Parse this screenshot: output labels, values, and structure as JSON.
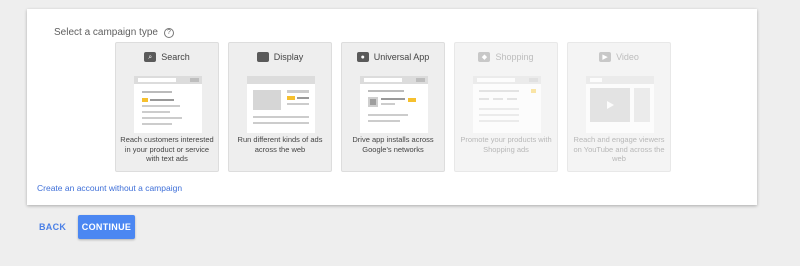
{
  "heading": "Select a campaign type",
  "help_icon": "?",
  "cards": [
    {
      "title": "Search",
      "icon": "search-icon",
      "glyph": "⌕",
      "description": "Reach customers interested in your product or service with text ads",
      "disabled": false
    },
    {
      "title": "Display",
      "icon": "display-icon",
      "glyph": "",
      "description": "Run different kinds of ads across the web",
      "disabled": false
    },
    {
      "title": "Universal App",
      "icon": "app-icon",
      "glyph": "●",
      "description": "Drive app installs across Google's networks",
      "disabled": false
    },
    {
      "title": "Shopping",
      "icon": "shopping-tag-icon",
      "glyph": "◆",
      "description": "Promote your products with Shopping ads",
      "disabled": true
    },
    {
      "title": "Video",
      "icon": "video-camera-icon",
      "glyph": "▶",
      "description": "Reach and engage viewers on YouTube and across the web",
      "disabled": true
    }
  ],
  "create_link": "Create an account without a campaign",
  "actions": {
    "back": "BACK",
    "continue": "CONTINUE"
  },
  "colors": {
    "accent": "#4b87f2",
    "link": "#3e6fd8",
    "highlight": "#f6c02e"
  }
}
